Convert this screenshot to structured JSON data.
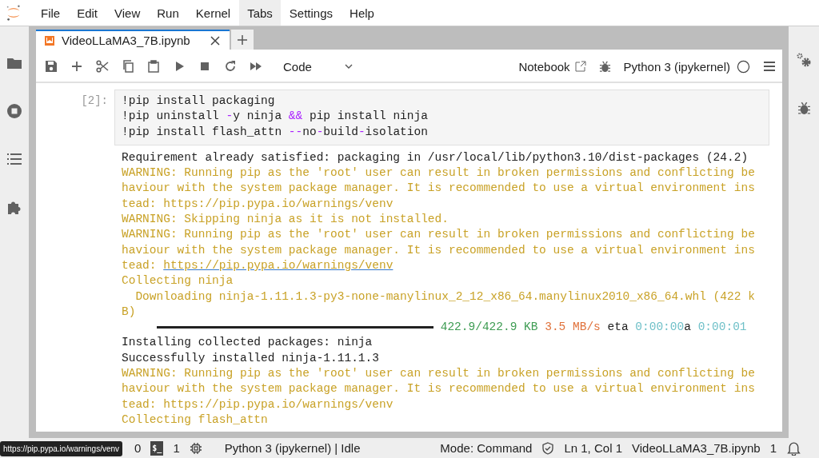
{
  "menu": [
    {
      "label": "File",
      "selected": false
    },
    {
      "label": "Edit",
      "selected": false
    },
    {
      "label": "View",
      "selected": false
    },
    {
      "label": "Run",
      "selected": false
    },
    {
      "label": "Kernel",
      "selected": false
    },
    {
      "label": "Tabs",
      "selected": true
    },
    {
      "label": "Settings",
      "selected": false
    },
    {
      "label": "Help",
      "selected": false
    }
  ],
  "left_sidebar": [
    {
      "kind": "folder",
      "selected": false
    },
    {
      "kind": "stop",
      "selected": false
    },
    {
      "kind": "list",
      "selected": false
    },
    {
      "kind": "puzzle",
      "selected": false
    }
  ],
  "right_sidebar": [
    {
      "kind": "gears"
    },
    {
      "kind": "bug"
    }
  ],
  "tabs": [
    {
      "label": "VideoLLaMA3_7B.ipynb",
      "selected": true
    }
  ],
  "toolbar": {
    "cell_type": "Code",
    "notebook_label": "Notebook",
    "kernel": "Python 3 (ipykernel)"
  },
  "cell": {
    "prompt": "[2]:",
    "code": [
      [
        {
          "kind": "text",
          "t": "!pip install packaging"
        }
      ],
      [
        {
          "kind": "text",
          "t": "!pip uninstall "
        },
        {
          "kind": "op",
          "t": "-"
        },
        {
          "kind": "text",
          "t": "y ninja "
        },
        {
          "kind": "op",
          "t": "&&"
        },
        {
          "kind": "text",
          "t": " pip install ninja"
        }
      ],
      [
        {
          "kind": "text",
          "t": "!pip install flash_attn "
        },
        {
          "kind": "op",
          "t": "--"
        },
        {
          "kind": "text",
          "t": "no"
        },
        {
          "kind": "op",
          "t": "-"
        },
        {
          "kind": "text",
          "t": "build"
        },
        {
          "kind": "op",
          "t": "-"
        },
        {
          "kind": "text",
          "t": "isolation"
        }
      ]
    ],
    "output": [
      {
        "kind": "plain",
        "text": "Requirement already satisfied: packaging in /usr/local/lib/python3.10/dist-packages (24.2)"
      },
      {
        "kind": "warning",
        "text": "WARNING: Running pip as the 'root' user can result in broken permissions and conflicting be"
      },
      {
        "kind": "warning",
        "text": "haviour with the system package manager. It is recommended to use a virtual environment ins"
      },
      {
        "kind": "warning",
        "text": "tead: https://pip.pypa.io/warnings/venv"
      },
      {
        "kind": "warning",
        "text": "WARNING: Skipping ninja as it is not installed."
      },
      {
        "kind": "warning",
        "text": "WARNING: Running pip as the 'root' user can result in broken permissions and conflicting be"
      },
      {
        "kind": "warning",
        "text": "haviour with the system package manager. It is recommended to use a virtual environment ins"
      },
      {
        "kind": "link",
        "text": "tead: ",
        "link": "https://pip.pypa.io/warnings/venv"
      },
      {
        "kind": "warning",
        "text": "Collecting ninja"
      },
      {
        "kind": "warning",
        "text": "  Downloading ninja-1.11.1.3-py3-none-manylinux_2_12_x86_64.manylinux2010_x86_64.whl (422 k"
      },
      {
        "kind": "warning",
        "text": "B)"
      },
      {
        "kind": "progress",
        "level": 1,
        "size": "422.9/422.9 KB",
        "speed": "3.5 MB/s",
        "eta_label": "eta",
        "eta": "0:00:00",
        "suffix": "a",
        "time": "0:00:01"
      },
      {
        "kind": "plain",
        "text": "Installing collected packages: ninja"
      },
      {
        "kind": "plain",
        "text": "Successfully installed ninja-1.11.1.3"
      },
      {
        "kind": "warning",
        "text": "WARNING: Running pip as the 'root' user can result in broken permissions and conflicting be"
      },
      {
        "kind": "warning",
        "text": "haviour with the system package manager. It is recommended to use a virtual environment ins"
      },
      {
        "kind": "warning",
        "text": "tead: https://pip.pypa.io/warnings/venv"
      },
      {
        "kind": "warning",
        "text": "Collecting flash_attn"
      }
    ]
  },
  "status_bar": {
    "terminals": "0",
    "terminal_glyph": "$_",
    "kernels": "1",
    "kernel_status": "Python 3 (ipykernel) | Idle",
    "mode": "Mode: Command",
    "position": "Ln 1, Col 1",
    "file": "VideoLLaMA3_7B.ipynb",
    "notifications": "1"
  },
  "tooltip": "https://pip.pypa.io/warnings/venv"
}
